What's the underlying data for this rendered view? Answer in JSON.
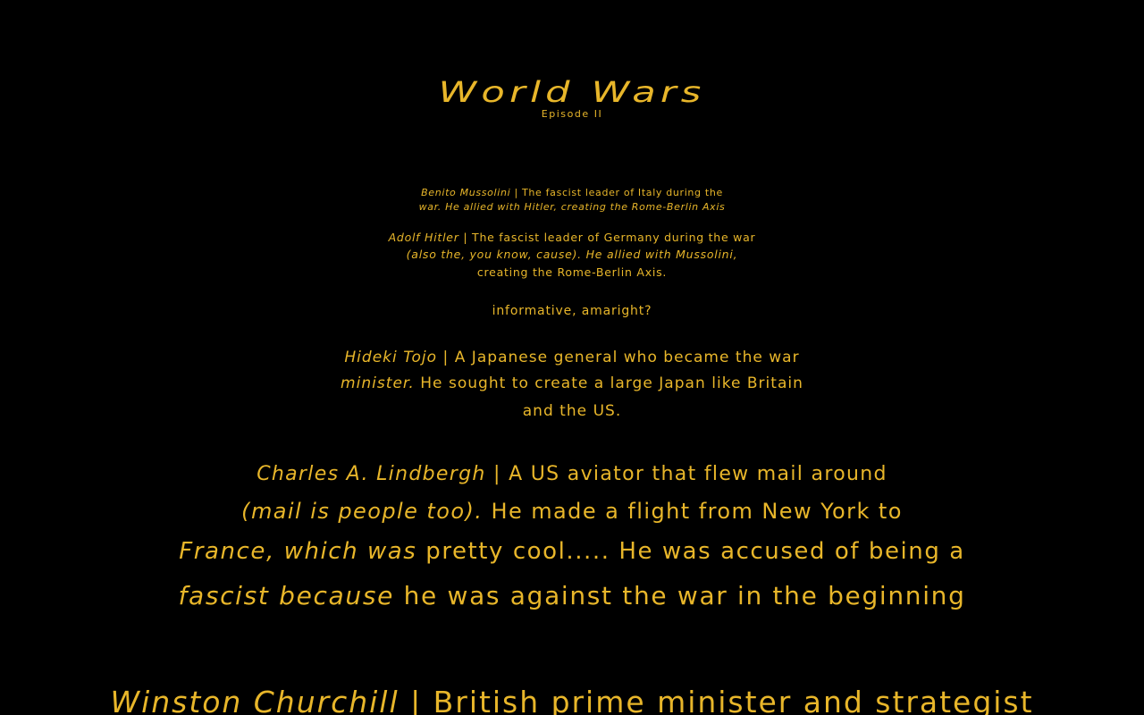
{
  "crawl": {
    "title": "World Wars",
    "subtitle": "Episode II",
    "paragraphs": [
      {
        "name": "Benito Mussolini",
        "lines": [
          "| The fascist leader of Italy during the",
          "war.  He allied with Hitler, creating the Rome-Berlin Axis"
        ],
        "line1_full_prefix": "Benito Mussolini",
        "line2": "war.  He allied with Hitler, creating the Rome-Berlin Axis"
      },
      {
        "name": "Adolf Hitler",
        "line1_rest": "| The fascist leader of Germany during the war",
        "line2": "(also the, you know, cause).  He allied with Mussolini,",
        "line3": "creating the Rome-Berlin Axis."
      },
      {
        "aside": "informative, amaright?"
      },
      {
        "name": "Hideki Tojo",
        "line1_rest": "| A Japanese general who became the war",
        "line2_it": "minister.",
        "line2_rest": "He sought to create a large Japan like Britain",
        "line3": "and the US."
      },
      {
        "name": "Charles A. Lindbergh",
        "line1_rest": "| A US aviator that flew mail around",
        "line2_it": "(mail is people too).",
        "line2_rest": "He made a flight from New York to",
        "line3_it": "France, which was",
        "line3_rest": "pretty cool.....  He was accused of being a",
        "line4_it": "fascist because",
        "line4_rest": "he was against the war in the beginning"
      },
      {
        "name": "Winston Churchill",
        "line1_rest": "| British prime minister and strategist"
      }
    ]
  },
  "colors": {
    "background": "#000000",
    "text": "#e8b62a"
  }
}
